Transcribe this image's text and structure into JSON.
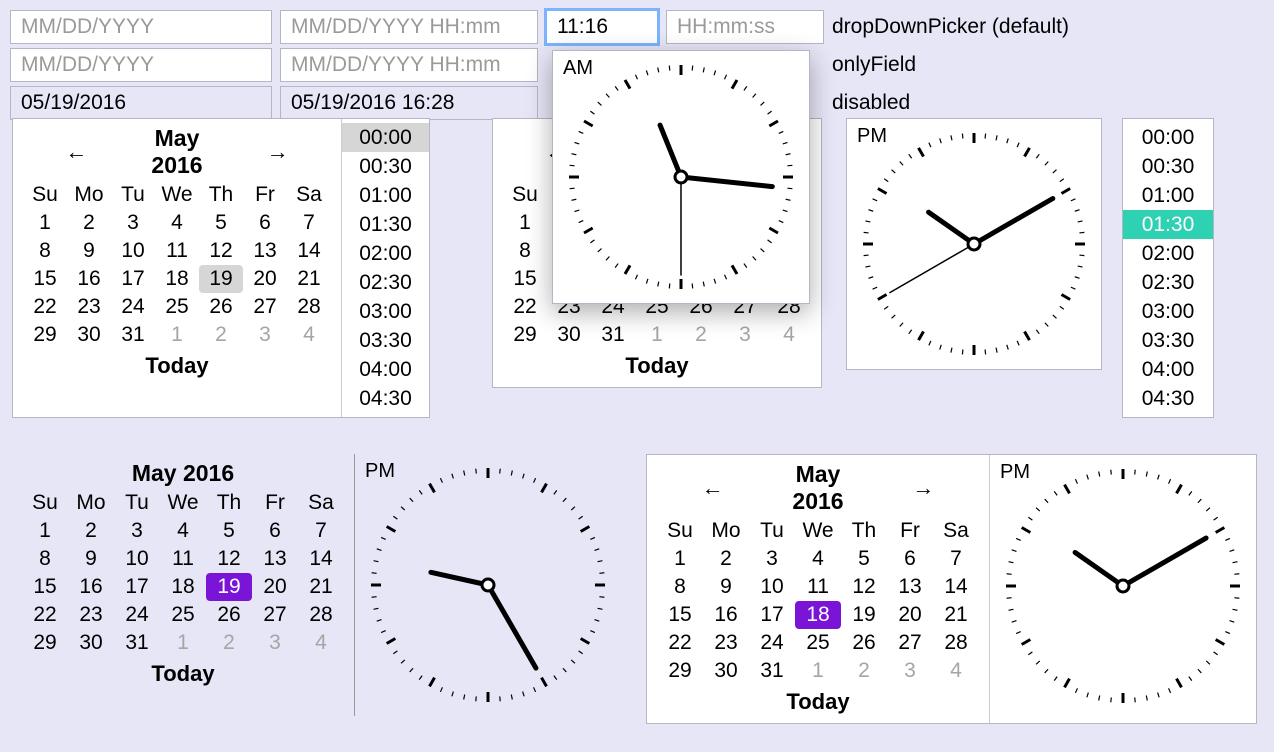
{
  "placeholders": {
    "date": "MM/DD/YYYY",
    "datetime": "MM/DD/YYYY HH:mm",
    "time": "HH:mm",
    "timess": "HH:mm:ss"
  },
  "values": {
    "date3": "05/19/2016",
    "datetime3": "05/19/2016 16:28",
    "time_focused": "11:16"
  },
  "labels": {
    "dropdown": "dropDownPicker (default)",
    "onlyfield": "onlyField",
    "disabled": "disabled"
  },
  "calendar": {
    "title": "May 2016",
    "weekdays": [
      "Su",
      "Mo",
      "Tu",
      "We",
      "Th",
      "Fr",
      "Sa"
    ],
    "days": [
      {
        "d": "1"
      },
      {
        "d": "2"
      },
      {
        "d": "3"
      },
      {
        "d": "4"
      },
      {
        "d": "5"
      },
      {
        "d": "6"
      },
      {
        "d": "7"
      },
      {
        "d": "8"
      },
      {
        "d": "9"
      },
      {
        "d": "10"
      },
      {
        "d": "11"
      },
      {
        "d": "12"
      },
      {
        "d": "13"
      },
      {
        "d": "14"
      },
      {
        "d": "15"
      },
      {
        "d": "16"
      },
      {
        "d": "17"
      },
      {
        "d": "18"
      },
      {
        "d": "19"
      },
      {
        "d": "20"
      },
      {
        "d": "21"
      },
      {
        "d": "22"
      },
      {
        "d": "23"
      },
      {
        "d": "24"
      },
      {
        "d": "25"
      },
      {
        "d": "26"
      },
      {
        "d": "27"
      },
      {
        "d": "28"
      },
      {
        "d": "29"
      },
      {
        "d": "30"
      },
      {
        "d": "31"
      },
      {
        "d": "1",
        "dim": true
      },
      {
        "d": "2",
        "dim": true
      },
      {
        "d": "3",
        "dim": true
      },
      {
        "d": "4",
        "dim": true
      }
    ],
    "today": "Today"
  },
  "times_a": [
    "00:00",
    "00:30",
    "01:00",
    "01:30",
    "02:00",
    "02:30",
    "03:00",
    "03:30",
    "04:00",
    "04:30"
  ],
  "times_b": [
    "00:00",
    "00:30",
    "01:00",
    "01:30",
    "02:00",
    "02:30",
    "03:00",
    "03:30",
    "04:00",
    "04:30"
  ],
  "times_a_sel": "00:00",
  "times_b_sel": "01:30",
  "clocks": {
    "popup": {
      "ampm": "AM",
      "hour": 11,
      "min": 16,
      "sec": 30,
      "showsec": true,
      "size": 240
    },
    "pm_box": {
      "ampm": "PM",
      "hour": 10,
      "min": 10,
      "sec": 40,
      "showsec": true,
      "size": 238
    },
    "bl": {
      "ampm": "PM",
      "hour": 9,
      "min": 25,
      "sec": 0,
      "showsec": false,
      "size": 250
    },
    "br": {
      "ampm": "PM",
      "hour": 10,
      "min": 10,
      "sec": 0,
      "showsec": false,
      "size": 250
    }
  },
  "sel": {
    "cal1": 19,
    "cal2": 19,
    "cal_bl": 19,
    "cal_br": 18
  }
}
